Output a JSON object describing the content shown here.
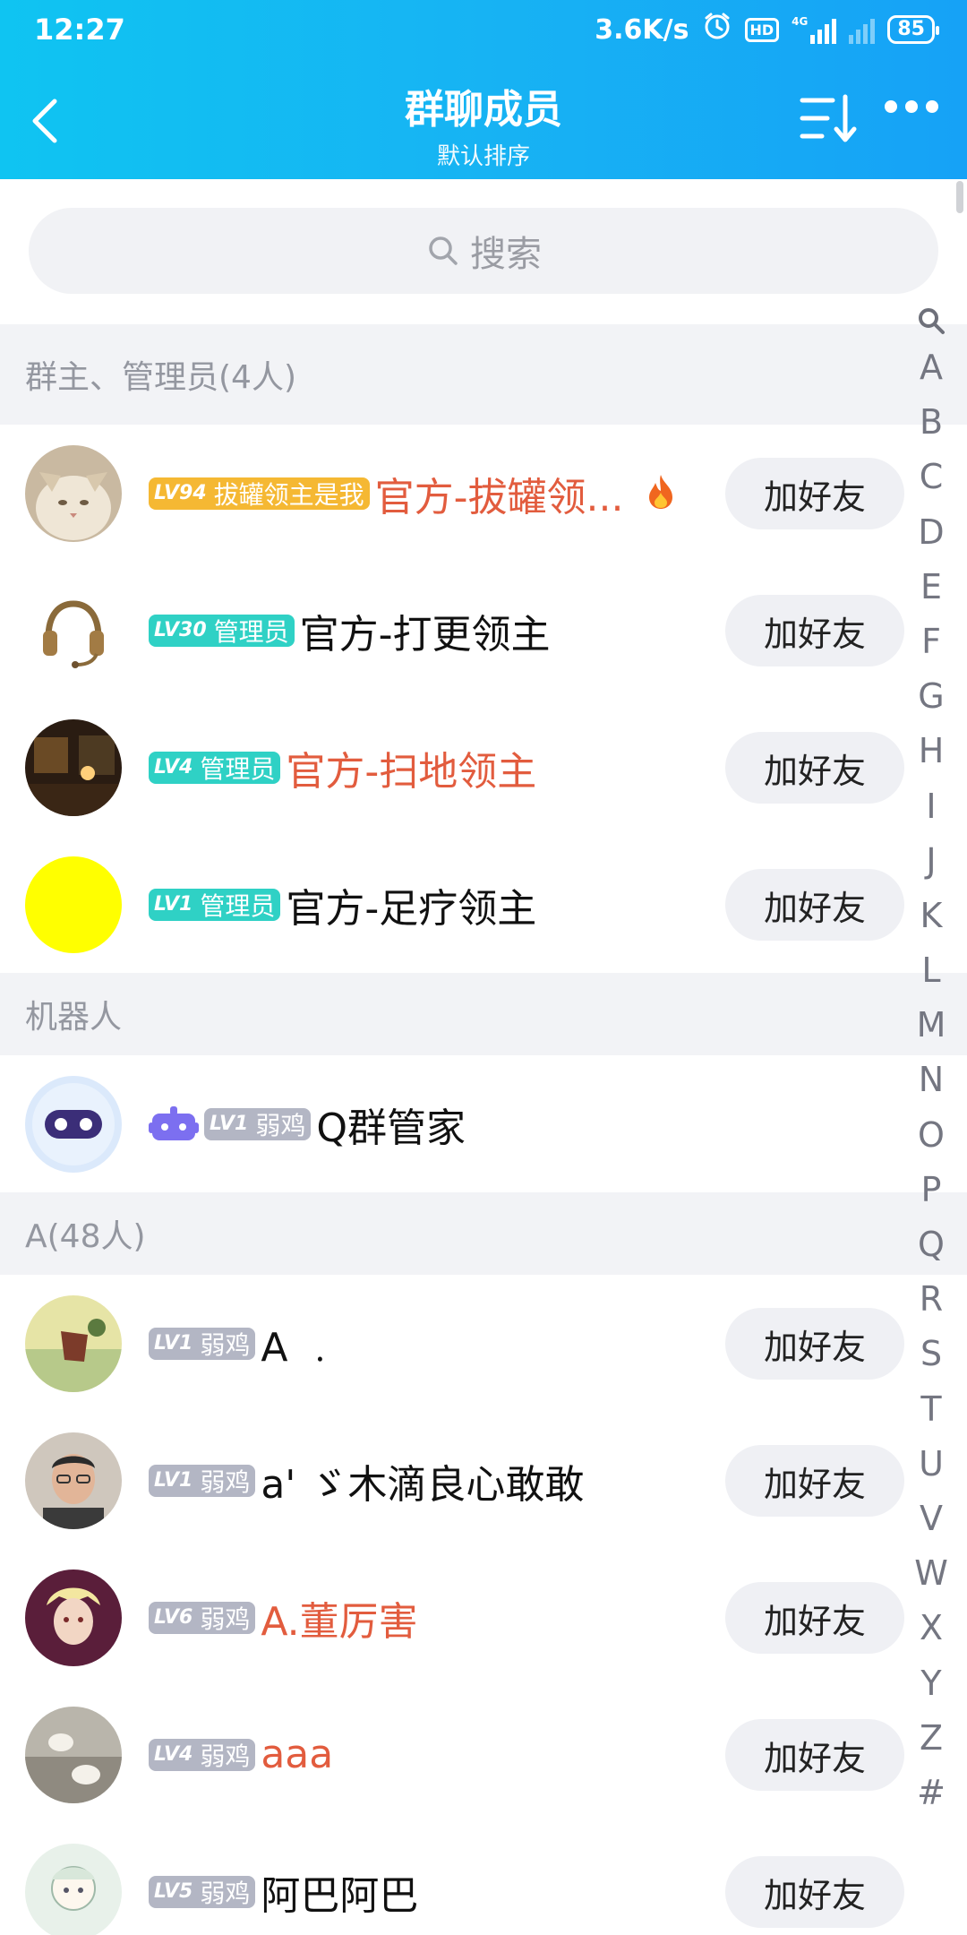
{
  "status": {
    "time": "12:27",
    "speed": "3.6K/s",
    "battery": "85",
    "hd": "HD",
    "net": "4G"
  },
  "header": {
    "title": "群聊成员",
    "subtitle": "默认排序"
  },
  "search": {
    "placeholder": "搜索"
  },
  "sections": {
    "admins": "群主、管理员(4人)",
    "robots": "机器人",
    "a": "A(48人)"
  },
  "add_friend_label": "加好友",
  "members": [
    {
      "lv": "LV94",
      "title": "拔罐领主是我",
      "name": "官方-拔罐领...",
      "badge": "owner",
      "name_color": "red",
      "extra_icon": "fire-icon"
    },
    {
      "lv": "LV30",
      "title": "管理员",
      "name": "官方-打更领主",
      "badge": "admin",
      "name_color": "black"
    },
    {
      "lv": "LV4",
      "title": "管理员",
      "name": "官方-扫地领主",
      "badge": "admin",
      "name_color": "red"
    },
    {
      "lv": "LV1",
      "title": "管理员",
      "name": "官方-足疗领主",
      "badge": "admin",
      "name_color": "black"
    },
    {
      "lv": "LV1",
      "title": "弱鸡",
      "name": "Q群管家",
      "badge": "gray",
      "name_color": "black",
      "robot": true
    },
    {
      "lv": "LV1",
      "title": "弱鸡",
      "name": "A ﹒",
      "badge": "gray",
      "name_color": "black"
    },
    {
      "lv": "LV1",
      "title": "弱鸡",
      "name": "a' ゞ木滴良心敢敢",
      "badge": "gray",
      "name_color": "black"
    },
    {
      "lv": "LV6",
      "title": "弱鸡",
      "name": "A.董厉害",
      "badge": "gray",
      "name_color": "red"
    },
    {
      "lv": "LV4",
      "title": "弱鸡",
      "name": "aaa",
      "badge": "gray",
      "name_color": "red"
    },
    {
      "lv": "LV5",
      "title": "弱鸡",
      "name": "阿巴阿巴",
      "badge": "gray",
      "name_color": "black"
    }
  ],
  "index_letters": [
    "A",
    "B",
    "C",
    "D",
    "E",
    "F",
    "G",
    "H",
    "I",
    "J",
    "K",
    "L",
    "M",
    "N",
    "O",
    "P",
    "Q",
    "R",
    "S",
    "T",
    "U",
    "V",
    "W",
    "X",
    "Y",
    "Z",
    "#"
  ],
  "colors": {
    "header_start": "#0fc4f2",
    "header_end": "#16a2f6",
    "owner_badge": "#f5b833",
    "admin_badge": "#2fd1c5",
    "member_badge": "#b3b6c4",
    "red_name": "#e25c3e"
  }
}
